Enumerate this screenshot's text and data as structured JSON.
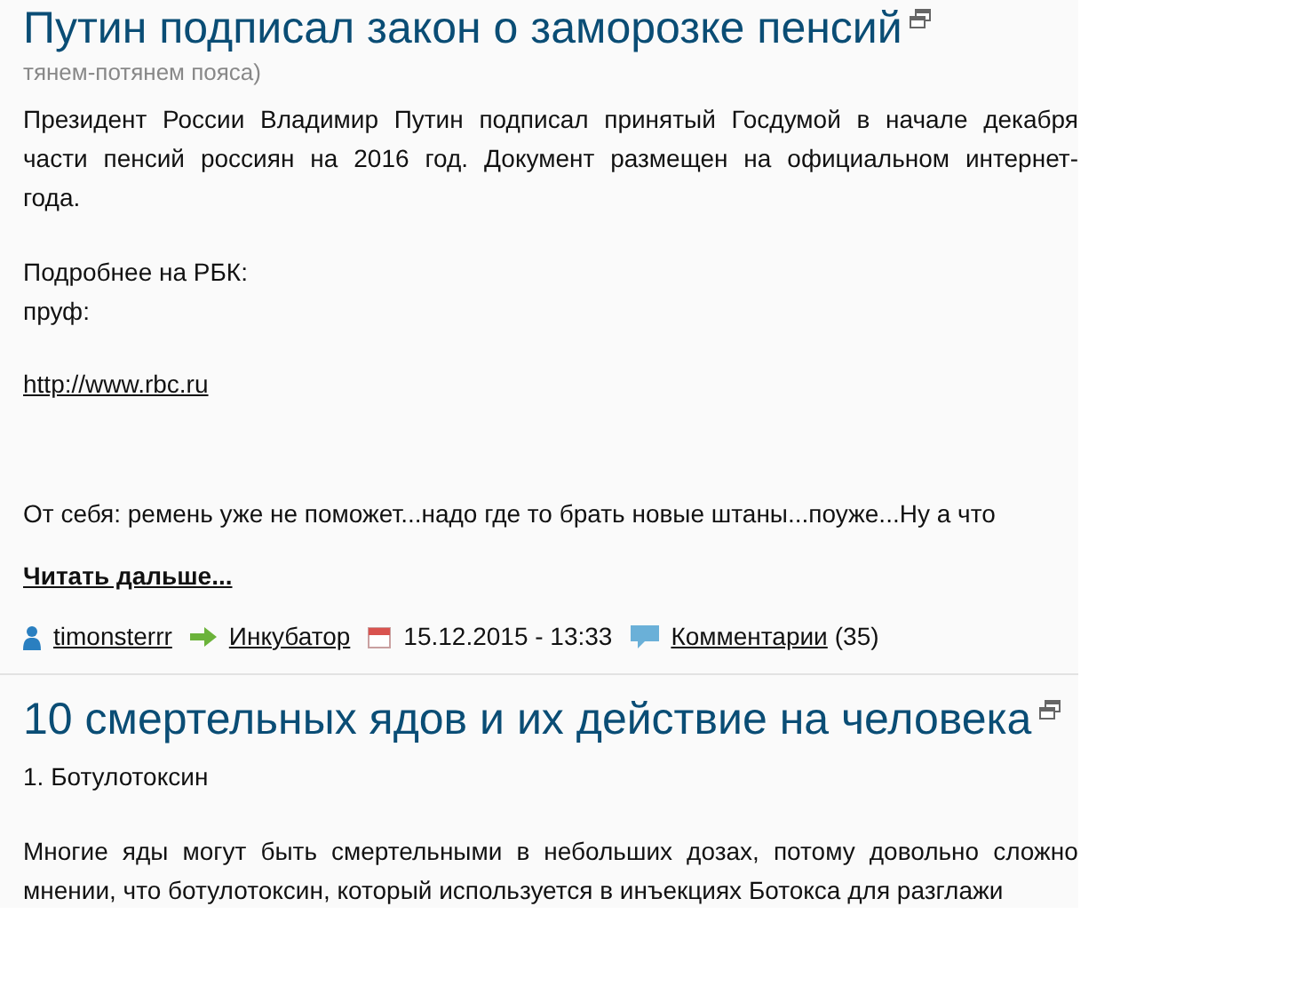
{
  "articles": [
    {
      "title": "Путин подписал закон о заморозке пенсий",
      "subtitle": "тянем-потянем пояса)",
      "paragraphs": [
        {
          "kind": "justified",
          "lines": [
            "Президент России Владимир Путин подписал принятый Госдумой в начале декабря",
            "части пенсий россиян на 2016 год. Документ размещен на официальном интернет-",
            "года."
          ]
        },
        {
          "kind": "text",
          "lines": [
            "Подробнее на РБК:",
            "пруф:"
          ]
        },
        {
          "kind": "link",
          "lines": [
            "http://www.rbc.ru"
          ]
        },
        {
          "kind": "text",
          "lines": [
            "От себя: ремень уже не поможет...надо где то брать новые штаны...поуже...Ну а что"
          ]
        }
      ],
      "read_more": "Читать дальше...",
      "meta": {
        "author": "timonsterrr",
        "category": "Инкубатор",
        "date": "15.12.2015 - 13:33",
        "comments_link": "Комментарии",
        "comments_count": "(35)"
      }
    },
    {
      "title": "10 смертельных ядов и их действие на человека",
      "paragraphs": [
        {
          "kind": "text",
          "lines": [
            "1. Ботулотоксин"
          ]
        },
        {
          "kind": "justified",
          "lines": [
            "Многие яды могут быть смертельными в небольших дозах, потому довольно сложно",
            "мнении, что ботулотоксин, который используется в инъекциях Ботокса для разглажи"
          ]
        }
      ]
    }
  ]
}
